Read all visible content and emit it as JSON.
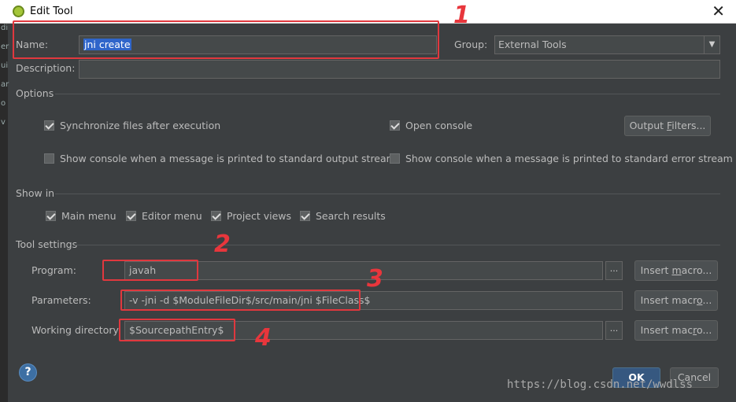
{
  "window": {
    "title": "Edit Tool",
    "close_glyph": "✕"
  },
  "left_strip": [
    "di",
    "er",
    "ui",
    "ar",
    "o",
    "v"
  ],
  "name": {
    "label": "Name:",
    "value": "jni create"
  },
  "group": {
    "label": "Group:",
    "value": "External Tools"
  },
  "description": {
    "label": "Description:",
    "value": ""
  },
  "options": {
    "title": "Options",
    "sync": {
      "label": "Synchronize files after execution",
      "checked": true
    },
    "open_console": {
      "label": "Open console",
      "checked": true
    },
    "output_filters": "Output Filters...",
    "show_console_stdout": {
      "label": "Show console when a message is printed to standard output stream",
      "checked": false
    },
    "show_console_stderr": {
      "label": "Show console when a message is printed to standard error stream",
      "checked": false
    }
  },
  "show_in": {
    "title": "Show in",
    "main_menu": {
      "label": "Main menu",
      "checked": true
    },
    "editor_menu": {
      "label": "Editor menu",
      "checked": true
    },
    "project_views": {
      "label": "Project views",
      "checked": true
    },
    "search_results": {
      "label": "Search results",
      "checked": true
    }
  },
  "tool_settings": {
    "title": "Tool settings",
    "program": {
      "label": "Program:",
      "value": "javah"
    },
    "parameters": {
      "label": "Parameters:",
      "value": "-v -jni -d $ModuleFileDir$/src/main/jni $FileClass$"
    },
    "working_dir": {
      "label": "Working directory:",
      "value": "$SourcepathEntry$"
    },
    "insert_macro": "Insert macro...",
    "ellipsis": "..."
  },
  "buttons": {
    "help": "?",
    "ok": "OK",
    "cancel": "Cancel"
  },
  "annotations": [
    "1",
    "2",
    "3",
    "4"
  ],
  "watermark": "https://blog.csdn.net/wwdlss",
  "colors": {
    "accent": "#365880",
    "annotation": "#e0383e",
    "selection": "#2f65ca"
  }
}
